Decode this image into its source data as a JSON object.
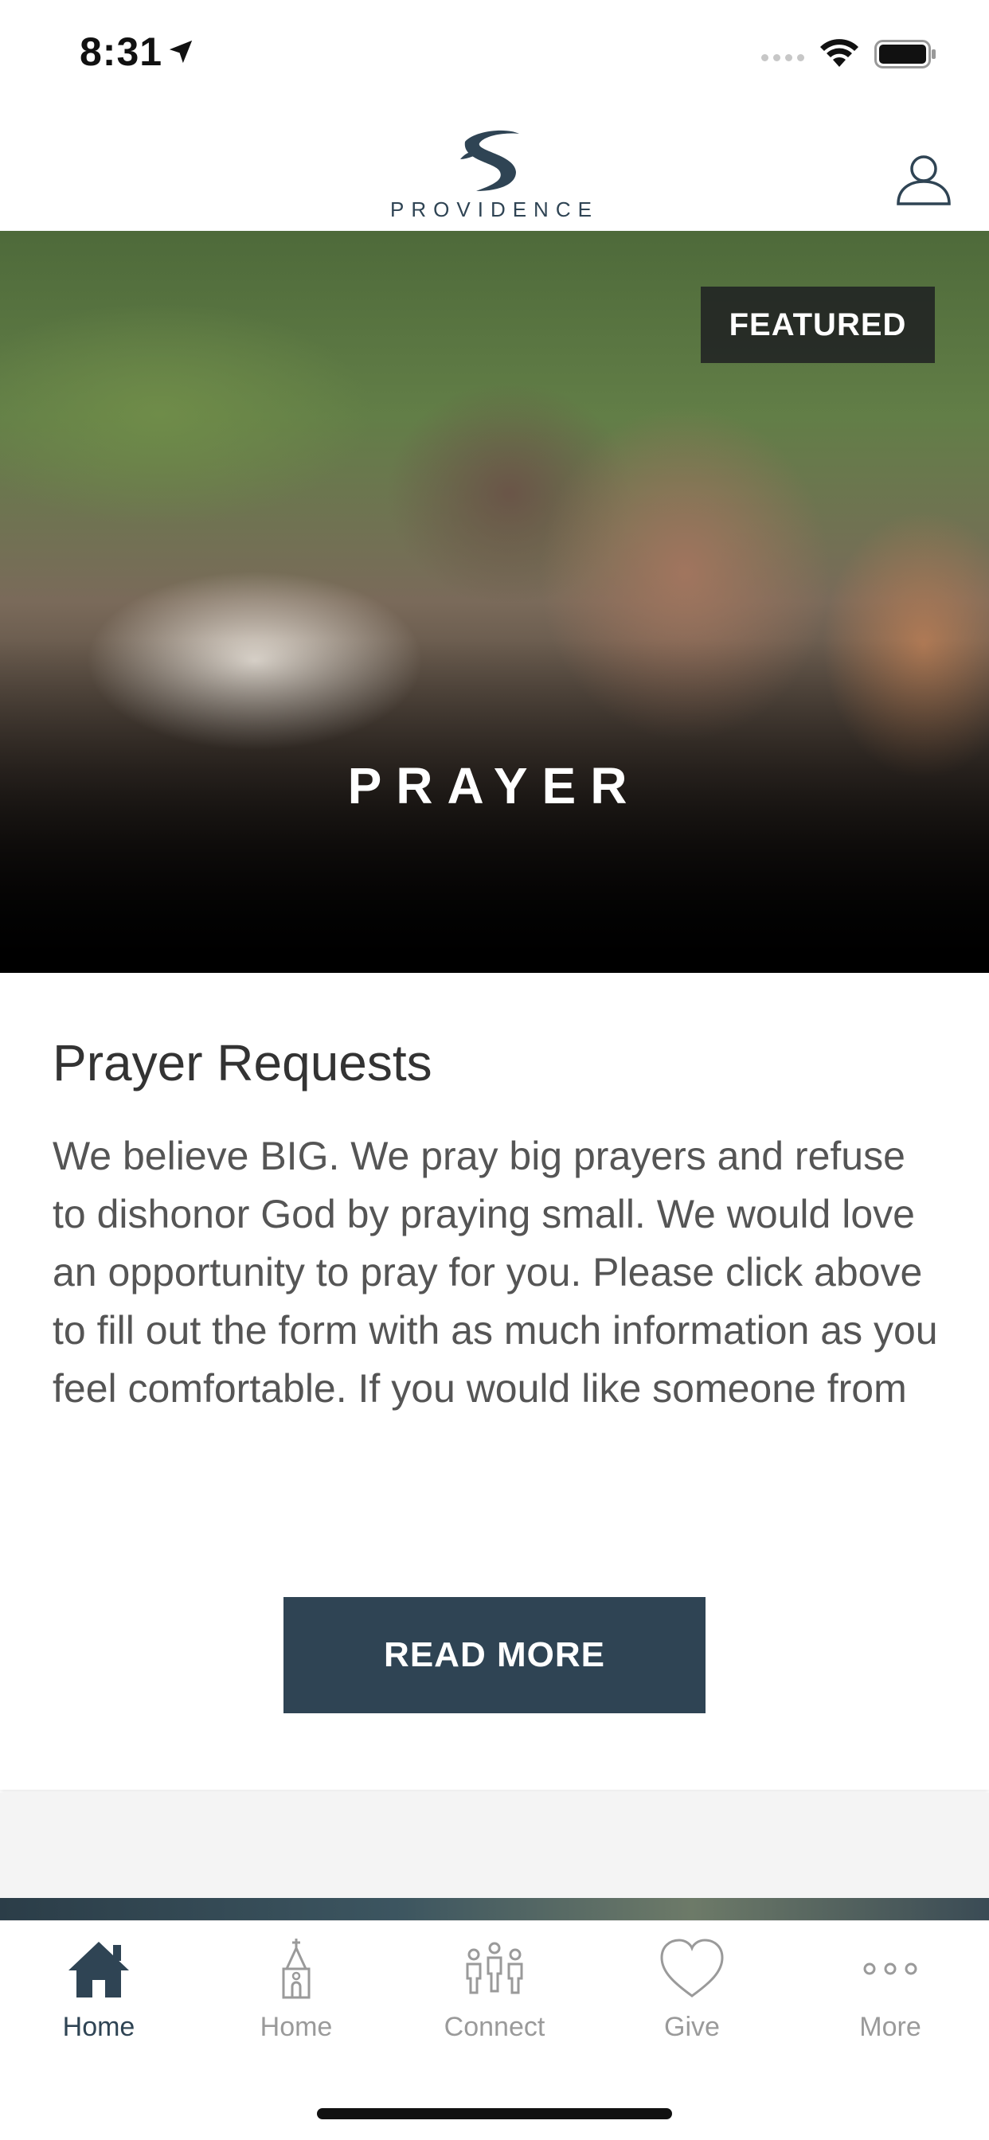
{
  "status_bar": {
    "time": "8:31"
  },
  "header": {
    "logo_text": "PROVIDENCE"
  },
  "feature": {
    "badge": "FEATURED",
    "hero_title": "PRAYER",
    "title": "Prayer Requests",
    "body": "We believe BIG. We pray big prayers and refuse to dishonor God by praying small. We would love an opportunity to pray for you. Please click above to fill out the form with as much information as you feel comfortable. If you would like someone from our prayer team to contact you please just let us know on the…",
    "button_label": "READ MORE"
  },
  "tabs": [
    {
      "label": "Home",
      "icon": "house-icon",
      "active": true
    },
    {
      "label": "Home",
      "icon": "church-icon",
      "active": false
    },
    {
      "label": "Connect",
      "icon": "people-icon",
      "active": false
    },
    {
      "label": "Give",
      "icon": "heart-icon",
      "active": false
    },
    {
      "label": "More",
      "icon": "ellipsis-icon",
      "active": false
    }
  ],
  "colors": {
    "brand": "#2f4454",
    "inactive": "#9a9a9a"
  }
}
